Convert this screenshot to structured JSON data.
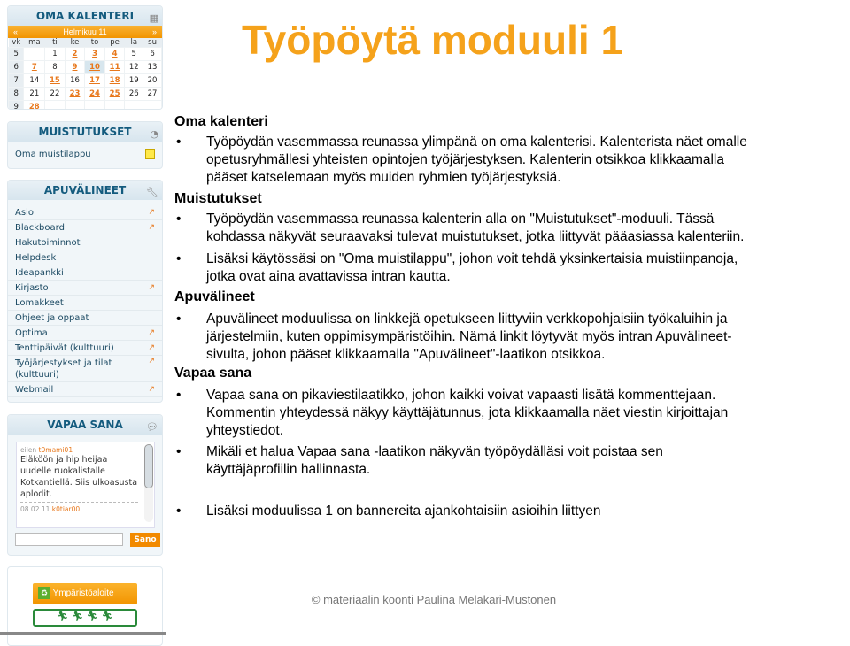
{
  "title": "Työpöytä moduuli 1",
  "calendar": {
    "header": "OMA KALENTERI",
    "month": "Helmikuu 11",
    "prev": "«",
    "next": "»",
    "days": [
      "vk",
      "ma",
      "ti",
      "ke",
      "to",
      "pe",
      "la",
      "su"
    ],
    "weeks": [
      {
        "vk": "5",
        "d": [
          "",
          "1",
          "2",
          "3",
          "4",
          "5",
          "6"
        ],
        "ev": [
          2,
          3,
          4
        ]
      },
      {
        "vk": "6",
        "d": [
          "7",
          "8",
          "9",
          "10",
          "11",
          "12",
          "13"
        ],
        "ev": [
          0,
          2,
          3,
          4
        ]
      },
      {
        "vk": "7",
        "d": [
          "14",
          "15",
          "16",
          "17",
          "18",
          "19",
          "20"
        ],
        "ev": [
          1,
          3,
          4
        ]
      },
      {
        "vk": "8",
        "d": [
          "21",
          "22",
          "23",
          "24",
          "25",
          "26",
          "27"
        ],
        "ev": [
          2,
          3,
          4
        ]
      },
      {
        "vk": "9",
        "d": [
          "28",
          "",
          "",
          "",
          "",
          "",
          ""
        ],
        "ev": [
          0
        ]
      }
    ],
    "today": "10"
  },
  "reminders": {
    "header": "MUISTUTUKSET",
    "item": "Oma muistilappu"
  },
  "tools": {
    "header": "APUVÄLINEET",
    "items": [
      {
        "label": "Asio",
        "ext": true
      },
      {
        "label": "Blackboard",
        "ext": true
      },
      {
        "label": "Hakutoiminnot",
        "ext": false
      },
      {
        "label": "Helpdesk",
        "ext": false
      },
      {
        "label": "Ideapankki",
        "ext": false
      },
      {
        "label": "Kirjasto",
        "ext": true
      },
      {
        "label": "Lomakkeet",
        "ext": false
      },
      {
        "label": "Ohjeet ja oppaat",
        "ext": false
      },
      {
        "label": "Optima",
        "ext": true
      },
      {
        "label": "Tenttipäivät (kulttuuri)",
        "ext": true
      },
      {
        "label": "Työjärjestykset ja tilat (kulttuuri)",
        "ext": true
      },
      {
        "label": "Webmail",
        "ext": true
      }
    ]
  },
  "freeword": {
    "header": "VAPAA SANA",
    "prev_meta": "eilen",
    "prev_user": "t0mami01",
    "message": "Eläköön ja hip heijaa uudelle ruokalistalle Kotkantiellä. Siis ulkoasusta aplodit.",
    "next_date": "08.02.11",
    "next_user": "k0tiar00",
    "input_value": "",
    "button": "Sano"
  },
  "banner": {
    "label": "Ympäristöaloite"
  },
  "content": {
    "h1": "Oma kalenteri",
    "p1": "Työpöydän vasemmassa reunassa ylimpänä on oma kalenterisi. Kalenterista näet omalle\nopetusryhmällesi yhteisten opintojen työjärjestyksen. Kalenterin otsikkoa klikkaamalla\npääset katselemaan myös muiden ryhmien työjärjestyksiä.",
    "h2": "Muistutukset",
    "p2": "Työpöydän vasemmassa reunassa kalenterin alla on \"Muistutukset\"-moduuli. Tässä\nkohdassa näkyvät seuraavaksi tulevat muistutukset, jotka liittyvät pääasiassa kalenteriin.",
    "p3": "Lisäksi käytössäsi on \"Oma muistilappu\", johon voit tehdä yksinkertaisia muistiinpanoja,\njotka ovat aina avattavissa intran kautta.",
    "h3": "Apuvälineet",
    "p4": "Apuvälineet moduulissa on linkkejä opetukseen liittyviin verkkopohjaisiin työkaluihin ja\njärjestelmiin, kuten oppimisympäristöihin. Nämä linkit löytyvät myös intran Apuvälineet-\nsivulta, johon pääset klikkaamalla \"Apuvälineet\"-laatikon otsikkoa.",
    "h4": "Vapaa sana",
    "p5": "Vapaa sana on pikaviestilaatikko, johon kaikki voivat vapaasti lisätä kommenttejaan.\nKommentin yhteydessä näkyy käyttäjätunnus, jota klikkaamalla näet viestin kirjoittajan\nyhteystiedot.",
    "p6": "Mikäli et halua Vapaa sana -laatikon näkyvän työpöydälläsi voit poistaa sen\nkäyttäjäprofiilin hallinnasta.",
    "p7": "Lisäksi moduulissa 1 on bannereita ajankohtaisiin asioihin liittyen",
    "bullet": "•"
  },
  "footer": "© materiaalin koonti  Paulina Melakari-Mustonen",
  "colors": {
    "accent": "#f5a21b",
    "module_header": "#145b7e",
    "link_event": "#e8781c"
  }
}
